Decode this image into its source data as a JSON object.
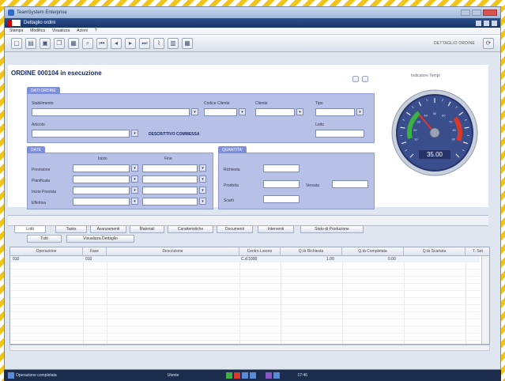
{
  "window": {
    "outer_title": "TeamSystem Enterprise",
    "inner_title": "Dettaglio ordini"
  },
  "menu": [
    "Stampa",
    "Modifica",
    "Visualizza",
    "Azioni",
    "?"
  ],
  "toolbar": {
    "buttons": [
      "new",
      "open",
      "save",
      "copy",
      "print",
      "search",
      "first",
      "prev",
      "next",
      "last",
      "attach",
      "view",
      "grid"
    ],
    "mode_label": "DETTAGLIO ORDINE"
  },
  "order": {
    "title": "ORDINE 000104 in esecuzione"
  },
  "dati_ordine": {
    "tab": "DATI ORDINE",
    "labels": {
      "stabilimento": "Stabilimento",
      "codice_cliente": "Codice Cliente",
      "cliente": "Cliente",
      "tipo": "Tipo",
      "articolo": "Articolo",
      "lotto": "Lotto",
      "descrizione_articolo": "DESCRITTIVO COMMESSA"
    }
  },
  "date": {
    "tab": "DATE",
    "col_inizio": "Inizio",
    "col_fine": "Fine",
    "rows": [
      "Previsione",
      "Pianificata",
      "Inizio Prevista",
      "Effettiva"
    ]
  },
  "quantita": {
    "tab": "QUANTITA'",
    "rows": [
      "Richiesta",
      "Prodotta",
      "Scarti"
    ],
    "extra_label": "Versata"
  },
  "gauge": {
    "label": "Indicatore Tempi",
    "value_text": "35.00",
    "value": 35,
    "min": 0,
    "max": 100,
    "tick_labels": [
      "10",
      "20",
      "30",
      "40",
      "50",
      "60",
      "70",
      "80",
      "90"
    ]
  },
  "tabs": [
    "Lotti",
    "Tasks",
    "Avanzamenti",
    "Materiali",
    "Caratteristiche",
    "Documenti",
    "Interventi",
    "Stato di Produzione"
  ],
  "sub_buttons": [
    "Tutti",
    "Visualizza Dettaglio"
  ],
  "grid": {
    "columns": [
      "Operazione",
      "Fase",
      "Descrizione",
      "Centro Lavoro",
      "Q.tà Richiesta",
      "Q.tà Completata",
      "Q.tà Scartata",
      "T. Set"
    ],
    "rows": [
      [
        "010",
        "010",
        "",
        "C.d.1000",
        "1.00",
        "0.00",
        "",
        ""
      ]
    ]
  },
  "statusbar": {
    "left_text": "Operazione completata",
    "user": "Utente",
    "time": "17:46"
  },
  "colors": {
    "panel": "#b7c0e6",
    "panel_tab": "#7d8fd8",
    "gauge_face": "#3a4d8c",
    "gauge_green": "#3cb043",
    "gauge_red": "#d63a2a",
    "status_bg": "#1c2c4c"
  }
}
